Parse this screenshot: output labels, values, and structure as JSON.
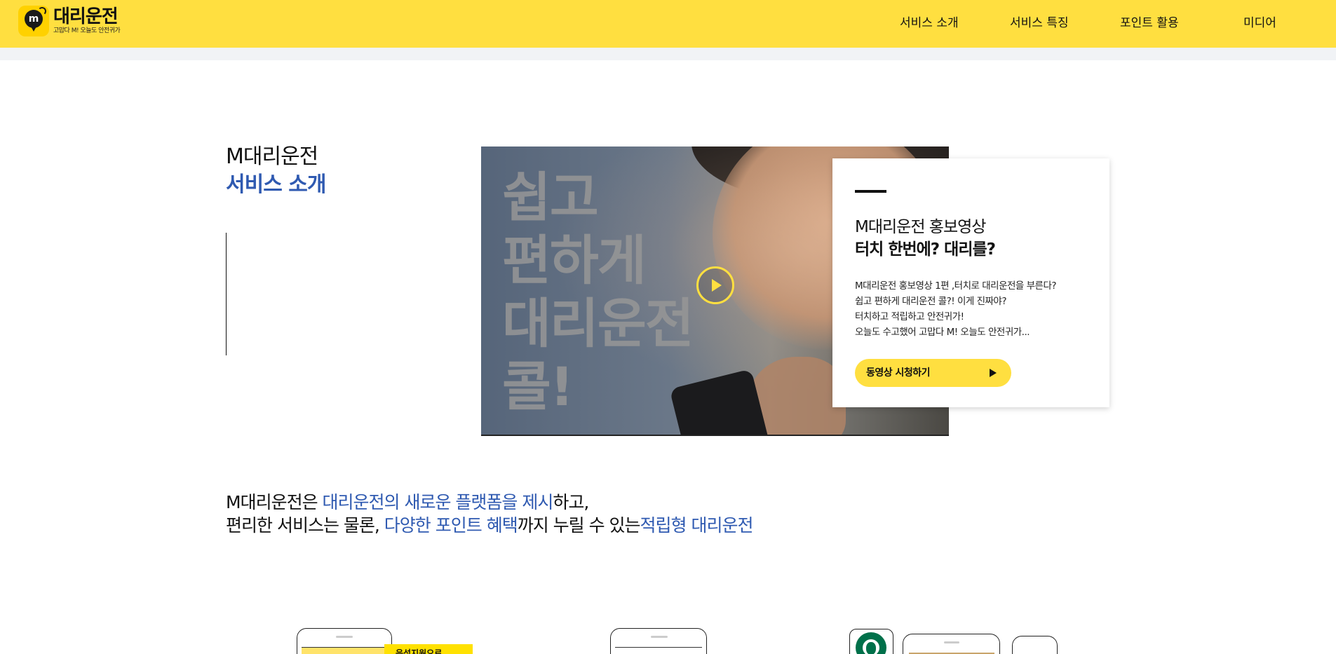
{
  "header": {
    "logo_title": "대리운전",
    "logo_subtitle": "고맙다 M! 오늘도 안전귀가",
    "nav": [
      "서비스 소개",
      "서비스 특징",
      "포인트 활용",
      "미디어"
    ],
    "bg_color": "#ffdf40"
  },
  "intro": {
    "line1": "M대리운전",
    "line2": "서비스 소개",
    "accent_color": "#2f5ab1"
  },
  "video": {
    "overlay_text": [
      "쉽고",
      "편하게",
      "대리운전",
      "콜!"
    ],
    "play_icon": "play-circle-icon"
  },
  "card": {
    "title1": "M대리운전 홍보영상",
    "title2": "터치 한번에? 대리를?",
    "description": [
      "M대리운전 홍보영상 1편 ,터치로 대리운전을 부른다?",
      "쉽고 편하게 대리운전 콜?! 이게 진짜야?",
      "터치하고 적립하고 안전귀가!",
      "오늘도 수고했어 고맙다 M! 오늘도 안전귀가..."
    ],
    "button_label": "동영상 시청하기",
    "button_icon": "play-icon"
  },
  "headline": {
    "line1_part1": "M대리운전은 ",
    "line1_highlight": "대리운전의 새로운 플랫폼을 제시",
    "line1_part2": "하고,",
    "line2_part1": "편리한 서비스는 물론, ",
    "line2_highlight1": "다양한 포인트 혜택",
    "line2_part2": "까지 누릴 수 있는",
    "line2_highlight2": "적립형 대리운전"
  },
  "bottom": {
    "tag_label": "음성지원으로"
  }
}
